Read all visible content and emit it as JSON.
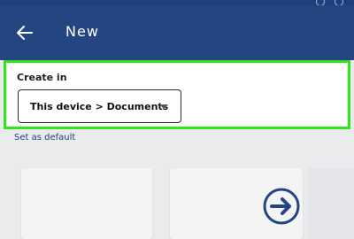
{
  "colors": {
    "app_bar": "#234683",
    "highlight": "#2fe61a",
    "background": "#eaebed",
    "link": "#1f3f7d"
  },
  "app_bar": {
    "back_icon": "arrow-left-icon",
    "title": "New"
  },
  "create_in": {
    "label": "Create in",
    "selected_location": "This device > Documents",
    "dropdown_icon": "caret-down-icon"
  },
  "set_default_label": "Set as default",
  "templates": {
    "next_icon": "arrow-right-circle-icon"
  }
}
